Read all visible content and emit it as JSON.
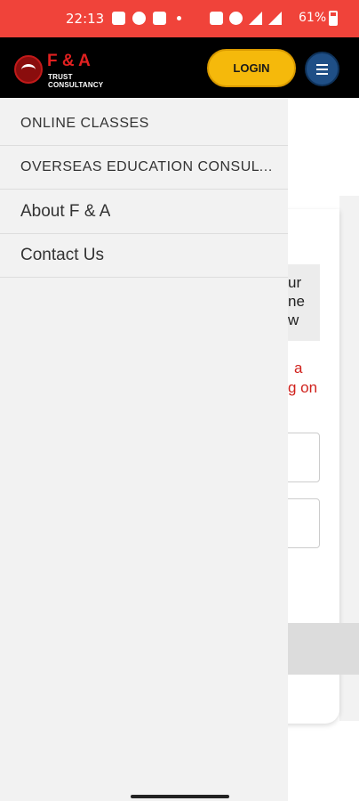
{
  "status_bar": {
    "time": "22:13",
    "battery": "61%",
    "left_icons": [
      "news-icon",
      "facebook-icon",
      "pocket-icon",
      "dot-icon"
    ],
    "right_icons": [
      "nfc-icon",
      "hotspot-icon",
      "data-4g-icon",
      "signal-icon"
    ]
  },
  "header": {
    "logo_title": "F & A",
    "logo_subtitle": "TRUST CONSULTANCY",
    "login_label": "LOGIN",
    "menu_icon": "hamburger-icon"
  },
  "background_content": {
    "gray_box_lines": [
      "ur",
      "ne",
      "w"
    ],
    "red_lines": [
      "a",
      "g on"
    ]
  },
  "drawer": {
    "items": [
      {
        "label": "ONLINE CLASSES"
      },
      {
        "label": "OVERSEAS EDUCATION CONSULTANCY"
      },
      {
        "label": "About F & A"
      },
      {
        "label": "Contact Us"
      }
    ]
  },
  "colors": {
    "status_bar": "#f0433a",
    "header": "#000000",
    "login_button": "#f5b90b",
    "menu_button": "#1f4f86",
    "drawer_bg": "#f2f2f2",
    "accent_red": "#d0211c"
  }
}
